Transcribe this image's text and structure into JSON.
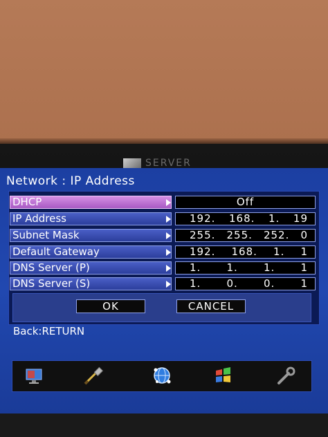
{
  "window": {
    "title": "Network : IP Address"
  },
  "behind_text": "SERVER",
  "rows": [
    {
      "label": "DHCP",
      "value": "Off",
      "selected": true
    },
    {
      "label": "IP Address",
      "octets": [
        "192.",
        "168.",
        "1.",
        "19"
      ]
    },
    {
      "label": "Subnet Mask",
      "octets": [
        "255.",
        "255.",
        "252.",
        "0"
      ]
    },
    {
      "label": "Default Gateway",
      "octets": [
        "192.",
        "168.",
        "1.",
        "1"
      ]
    },
    {
      "label": "DNS Server (P)",
      "octets": [
        "1.",
        "1.",
        "1.",
        "1"
      ]
    },
    {
      "label": "DNS Server (S)",
      "octets": [
        "1.",
        "0.",
        "0.",
        "1"
      ]
    }
  ],
  "buttons": {
    "ok": "OK",
    "cancel": "CANCEL"
  },
  "hint": "Back:RETURN",
  "icons": [
    "monitor-icon",
    "cable-icon",
    "network-globe-icon",
    "windows-flag-icon",
    "wrench-icon"
  ],
  "colors": {
    "selected_row": "#c77ad9",
    "screen_bg": "#1f45ab",
    "row_bg": "#34479f"
  }
}
